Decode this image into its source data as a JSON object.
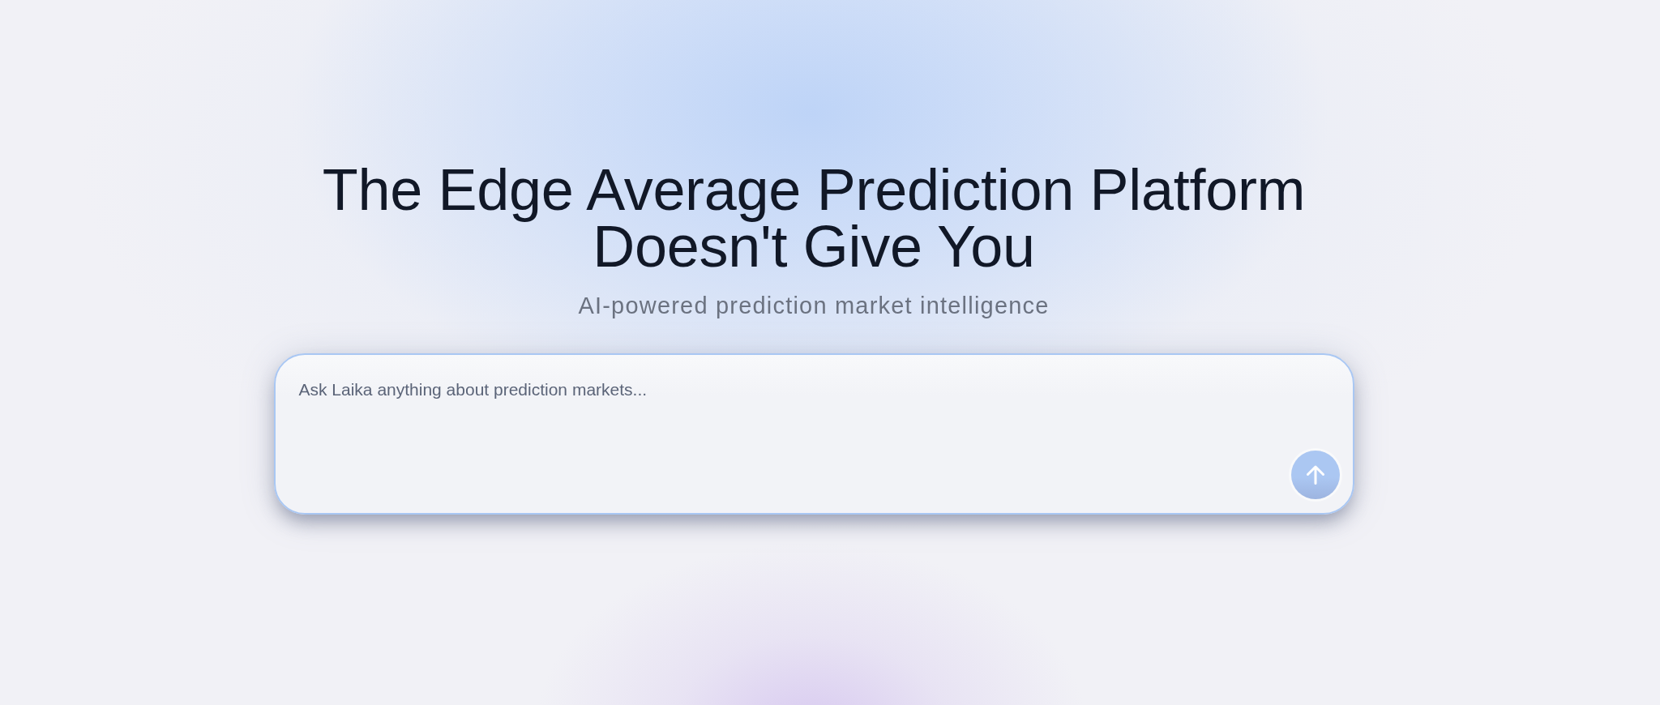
{
  "hero": {
    "title": "The Edge Average Prediction Platform Doesn't Give You",
    "subtitle": "AI-powered prediction market intelligence"
  },
  "chat_input": {
    "placeholder": "Ask Laika anything about prediction markets..."
  }
}
